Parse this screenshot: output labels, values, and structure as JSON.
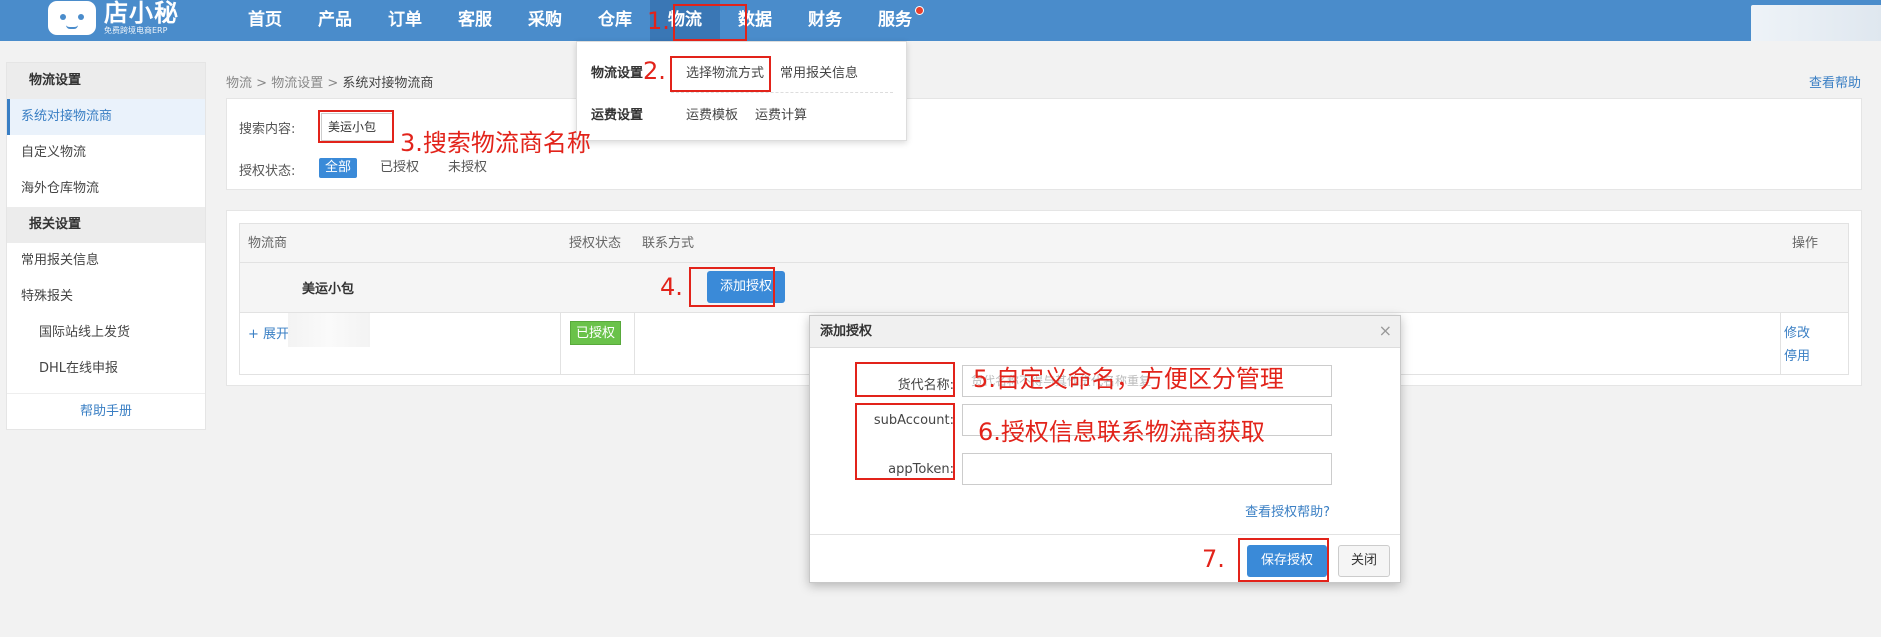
{
  "logo": {
    "name": "店小秘",
    "tagline": "免费跨境电商ERP"
  },
  "nav": [
    "首页",
    "产品",
    "订单",
    "客服",
    "采购",
    "仓库",
    "物流",
    "数据",
    "财务",
    "服务"
  ],
  "sidebar": {
    "section1": "物流设置",
    "items1": [
      "系统对接物流商",
      "自定义物流",
      "海外仓库物流"
    ],
    "section2": "报关设置",
    "items2": [
      "常用报关信息",
      "特殊报关"
    ],
    "subitems": [
      "国际站线上发货",
      "DHL在线申报"
    ],
    "help": "帮助手册"
  },
  "breadcrumb": {
    "p1": "物流",
    "sep": ">",
    "p2": "物流设置",
    "p3": "系统对接物流商"
  },
  "help_link": "查看帮助",
  "search": {
    "label": "搜索内容:",
    "value": "美运小包",
    "status_label": "授权状态:",
    "filters": [
      "全部",
      "已授权",
      "未授权"
    ]
  },
  "table": {
    "headers": [
      "物流商",
      "授权状态",
      "联系方式",
      "操作"
    ],
    "group_name": "美运小包",
    "add_button": "添加授权",
    "expand": "+ 展开",
    "status": "已授权",
    "ops": [
      "修改",
      "停用"
    ]
  },
  "dropdown": {
    "title1": "物流设置",
    "links1": [
      "选择物流方式",
      "常用报关信息"
    ],
    "title2": "运费设置",
    "links2": [
      "运费模板",
      "运费计算"
    ]
  },
  "modal": {
    "title": "添加授权",
    "close": "×",
    "fields": [
      "货代名称:",
      "subAccount:",
      "appToken:"
    ],
    "placeholder": "货代名称不得与其他货代名称重复",
    "help": "查看授权帮助?",
    "save": "保存授权",
    "cancel": "关闭"
  },
  "annotations": {
    "a1": "1.",
    "a2": "2.",
    "a3": "3.搜索物流商名称",
    "a4": "4.",
    "a5": "5.自定义命名，方便区分管理",
    "a6": "6.授权信息联系物流商获取",
    "a7": "7."
  },
  "colors": {
    "brand": "#4a8ccb",
    "accent": "#3a8ad8",
    "annotation": "#e2231a",
    "authorized": "#6ac24a"
  }
}
